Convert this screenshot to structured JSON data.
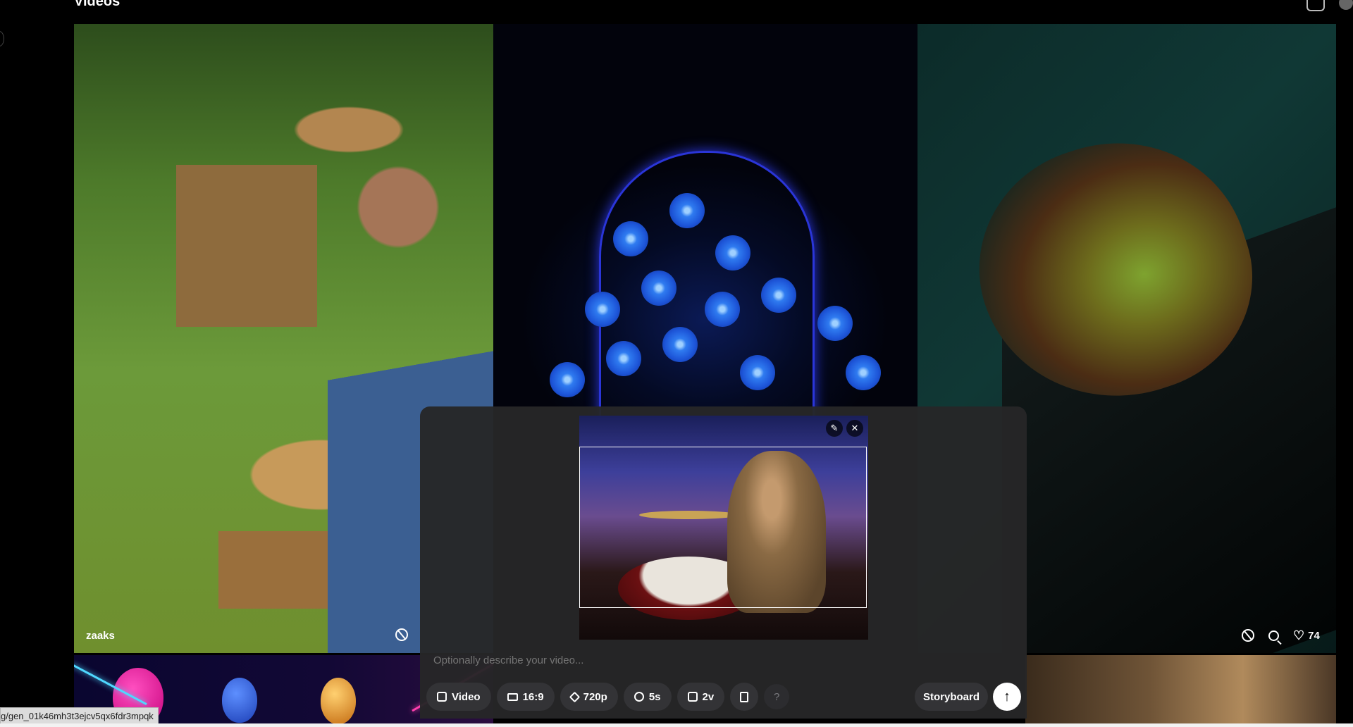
{
  "header": {
    "title": "Videos"
  },
  "gallery": {
    "tiles": [
      {
        "author": "zaaks"
      },
      {},
      {
        "likes": "74"
      }
    ]
  },
  "composer": {
    "prompt_placeholder": "Optionally describe your video...",
    "toolbar": {
      "mode_label": "Video",
      "aspect_label": "16:9",
      "resolution_label": "720p",
      "duration_label": "5s",
      "variations_label": "2v",
      "help_label": "?"
    },
    "storyboard_label": "Storyboard",
    "submit_symbol": "↑",
    "thumb_edit_symbol": "✎",
    "thumb_close_symbol": "✕"
  },
  "status_bar": {
    "url": "g/gen_01k46mh3t3ejcv5qx6fdr3mpqk"
  },
  "colors": {
    "background": "#000000",
    "panel": "#262628",
    "chip": "#333336",
    "submit": "#ffffff"
  }
}
